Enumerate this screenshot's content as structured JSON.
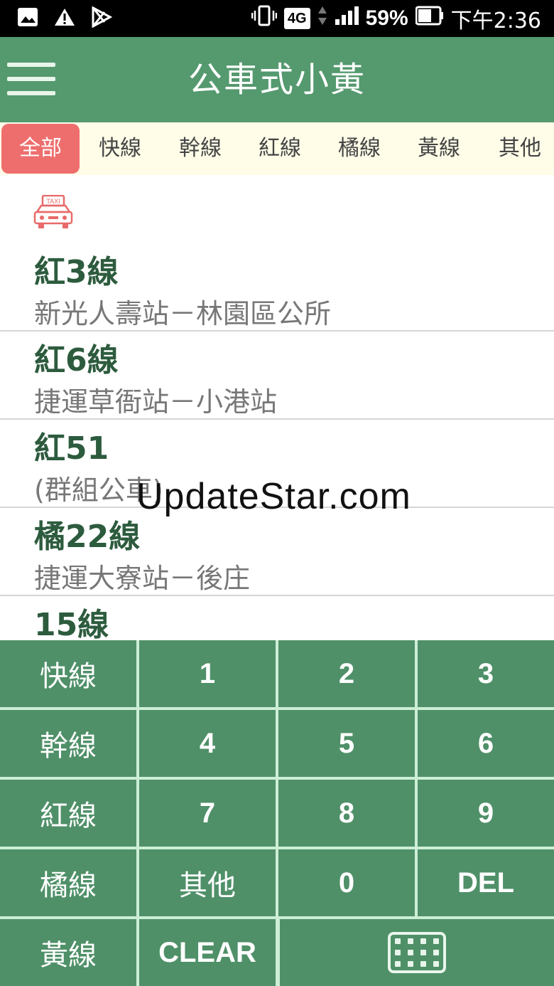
{
  "status_bar": {
    "network": "4G",
    "battery": "59%",
    "time": "下午2:36",
    "icons": [
      "image-icon",
      "warning-icon",
      "play-store-icon",
      "vibrate-icon",
      "signal-icon",
      "battery-icon"
    ]
  },
  "app_bar": {
    "title": "公車式小黃",
    "menu_icon": "hamburger-menu-icon"
  },
  "tabs": [
    {
      "label": "全部",
      "active": true
    },
    {
      "label": "快線",
      "active": false
    },
    {
      "label": "幹線",
      "active": false
    },
    {
      "label": "紅線",
      "active": false
    },
    {
      "label": "橘線",
      "active": false
    },
    {
      "label": "黃線",
      "active": false
    },
    {
      "label": "其他",
      "active": false
    }
  ],
  "list": {
    "header_icon": "taxi-icon",
    "header_icon_text": "TAXI",
    "routes": [
      {
        "name": "紅3線",
        "desc": "新光人壽站－林園區公所"
      },
      {
        "name": "紅6線",
        "desc": "捷運草衙站－小港站"
      },
      {
        "name": "紅51",
        "desc": "(群組公車)"
      },
      {
        "name": "橘22線",
        "desc": "捷運大寮站－後庄"
      },
      {
        "name": "15線",
        "desc": ""
      }
    ]
  },
  "watermark": "UpdateStar.com",
  "keypad": {
    "rows": [
      [
        "快線",
        "1",
        "2",
        "3"
      ],
      [
        "幹線",
        "4",
        "5",
        "6"
      ],
      [
        "紅線",
        "7",
        "8",
        "9"
      ],
      [
        "橘線",
        "其他",
        "0",
        "DEL"
      ],
      [
        "黃線",
        "CLEAR"
      ]
    ],
    "keyboard_icon": "keyboard-icon"
  },
  "colors": {
    "primary_green": "#55996f",
    "key_green": "#4f9068",
    "active_tab": "#ee6e6e",
    "route_title": "#2d5b3e"
  }
}
